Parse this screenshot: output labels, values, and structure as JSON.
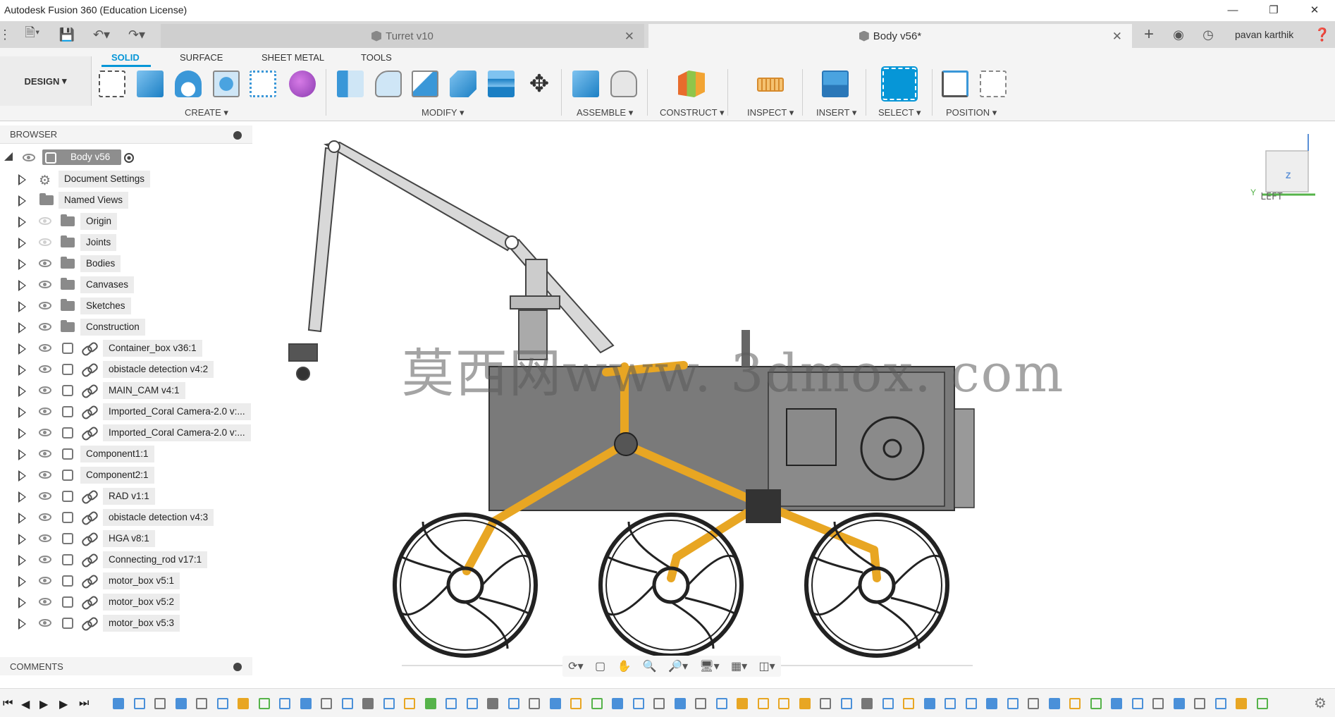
{
  "window": {
    "title": "Autodesk Fusion 360 (Education License)"
  },
  "tabs": [
    {
      "label": "Turret v10",
      "active": false
    },
    {
      "label": "Body v56*",
      "active": true
    }
  ],
  "user": {
    "name": "pavan karthik"
  },
  "toolbar": {
    "workspace_label": "DESIGN",
    "workspace_tabs": [
      "SOLID",
      "SURFACE",
      "SHEET METAL",
      "TOOLS"
    ],
    "groups": [
      "CREATE",
      "MODIFY",
      "ASSEMBLE",
      "CONSTRUCT",
      "INSPECT",
      "INSERT",
      "SELECT",
      "POSITION"
    ]
  },
  "browser": {
    "title": "BROWSER",
    "root": "Body v56",
    "items": [
      {
        "label": "Document Settings",
        "kind": "settings"
      },
      {
        "label": "Named Views",
        "kind": "folder"
      },
      {
        "label": "Origin",
        "kind": "folder",
        "hidden": true
      },
      {
        "label": "Joints",
        "kind": "folder",
        "hidden": true
      },
      {
        "label": "Bodies",
        "kind": "folder"
      },
      {
        "label": "Canvases",
        "kind": "folder"
      },
      {
        "label": "Sketches",
        "kind": "folder"
      },
      {
        "label": "Construction",
        "kind": "folder"
      },
      {
        "label": "Container_box v36:1",
        "kind": "link-comp"
      },
      {
        "label": "obistacle detection v4:2",
        "kind": "link-comp"
      },
      {
        "label": "MAIN_CAM v4:1",
        "kind": "link-comp"
      },
      {
        "label": "Imported_Coral Camera-2.0 v:...",
        "kind": "link-comp"
      },
      {
        "label": "Imported_Coral Camera-2.0 v:...",
        "kind": "link-comp"
      },
      {
        "label": "Component1:1",
        "kind": "comp"
      },
      {
        "label": "Component2:1",
        "kind": "comp"
      },
      {
        "label": "RAD v1:1",
        "kind": "link-comp"
      },
      {
        "label": "obistacle detection v4:3",
        "kind": "link-comp"
      },
      {
        "label": "HGA v8:1",
        "kind": "link-comp"
      },
      {
        "label": "Connecting_rod v17:1",
        "kind": "link-comp"
      },
      {
        "label": "motor_box v5:1",
        "kind": "link-comp"
      },
      {
        "label": "motor_box v5:2",
        "kind": "link-comp"
      },
      {
        "label": "motor_box v5:3",
        "kind": "link-comp"
      }
    ]
  },
  "comments": {
    "title": "COMMENTS"
  },
  "viewcube": {
    "face": "LEFT",
    "axis_z": "Z",
    "axis_y": "Y"
  },
  "watermark": "莫西网www. 3dmox. com",
  "colors": {
    "accent": "#0696d7",
    "frame_yellow": "#e8a623",
    "body_gray": "#777777"
  }
}
